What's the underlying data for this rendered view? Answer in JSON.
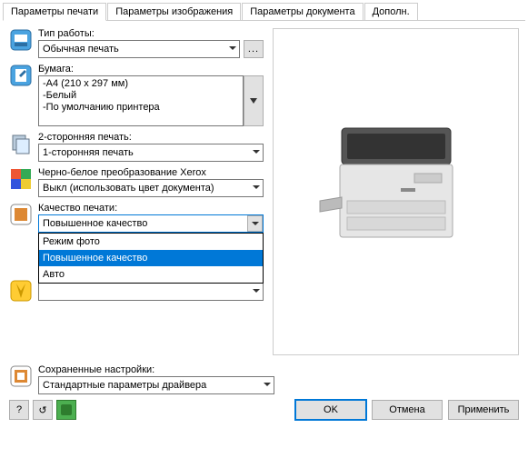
{
  "tabs": [
    "Параметры печати",
    "Параметры изображения",
    "Параметры документа",
    "Дополн."
  ],
  "job": {
    "label": "Тип работы:",
    "value": "Обычная печать"
  },
  "paper": {
    "label": "Бумага:",
    "lines": [
      "-A4 (210 x 297 мм)",
      "-Белый",
      "-По умолчанию принтера"
    ]
  },
  "duplex": {
    "label": "2-сторонняя печать:",
    "value": "1-сторонняя печать"
  },
  "bw": {
    "label": "Черно-белое преобразование Xerox",
    "value": "Выкл (использовать цвет документа)"
  },
  "quality": {
    "label": "Качество печати:",
    "value": "Повышенное качество",
    "options": [
      "Режим фото",
      "Повышенное качество",
      "Авто"
    ]
  },
  "saved": {
    "label": "Сохраненные настройки:",
    "value": "Стандартные параметры драйвера"
  },
  "buttons": {
    "ok": "OK",
    "cancel": "Отмена",
    "apply": "Применить",
    "help": "?",
    "reset": "↺"
  }
}
